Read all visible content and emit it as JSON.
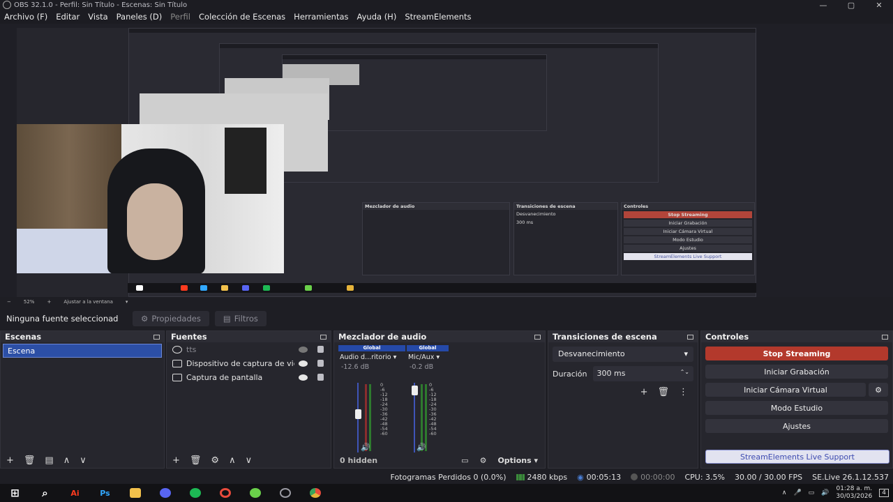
{
  "window": {
    "title": "OBS 32.1.0 - Perfil: Sin Título - Escenas: Sin Título",
    "min": "—",
    "max": "▢",
    "close": "✕"
  },
  "menu": [
    {
      "label": "Archivo (F)"
    },
    {
      "label": "Editar"
    },
    {
      "label": "Vista"
    },
    {
      "label": "Paneles (D)"
    },
    {
      "label": "Perfil",
      "disabled": true
    },
    {
      "label": "Colección de Escenas"
    },
    {
      "label": "Herramientas"
    },
    {
      "label": "Ayuda (H)"
    },
    {
      "label": "StreamElements"
    }
  ],
  "zoom": {
    "minus": "−",
    "value": "52%",
    "plus": "+",
    "fit": "Ajustar a la ventana",
    "arrow": "▾"
  },
  "context": {
    "no_source": "Ninguna fuente seleccionad",
    "properties": "Propiedades",
    "filters": "Filtros"
  },
  "scenes": {
    "title": "Escenas",
    "items": [
      "Escena"
    ]
  },
  "sources": {
    "title": "Fuentes",
    "items": [
      {
        "name": "tts",
        "visible": false
      },
      {
        "name": "Dispositivo de captura de vid",
        "visible": true
      },
      {
        "name": "Captura de pantalla",
        "visible": true
      }
    ]
  },
  "mixer": {
    "title": "Mezclador de audio",
    "global_label": "Global",
    "channels": [
      {
        "name": "Audio d...ritorio",
        "db": "-12.6 dB"
      },
      {
        "name": "Mic/Aux",
        "db": "-0.2 dB"
      }
    ],
    "scale": [
      "0",
      "-6",
      "-12",
      "-18",
      "-24",
      "-30",
      "-36",
      "-42",
      "-48",
      "-54",
      "-60"
    ],
    "hidden": "0 hidden",
    "options": "Options"
  },
  "transitions": {
    "title": "Transiciones de escena",
    "selected": "Desvanecimiento",
    "duration_label": "Duración",
    "duration_value": "300 ms"
  },
  "controls": {
    "title": "Controles",
    "stop_streaming": "Stop Streaming",
    "start_recording": "Iniciar Grabación",
    "virtual_cam": "Iniciar Cámara Virtual",
    "studio_mode": "Modo Estudio",
    "settings": "Ajustes",
    "se_support": "StreamElements Live Support"
  },
  "status": {
    "dropped": "Fotogramas Perdidos 0 (0.0%)",
    "bitrate": "2480 kbps",
    "stream_time": "00:05:13",
    "rec_time": "00:00:00",
    "cpu": "CPU: 3.5%",
    "fps": "30.00 / 30.00 FPS",
    "version": "SE.Live 26.1.12.537"
  },
  "taskbar": {
    "time": "01:28 a. m.",
    "date": "30/03/2026",
    "notif": "4",
    "apps": [
      {
        "icon": "windows-icon",
        "label": "⊞",
        "color": "#ffffff"
      },
      {
        "icon": "search-icon",
        "label": "⌕",
        "color": "#ffffff"
      },
      {
        "icon": "illustrator-icon",
        "label": "Ai",
        "color": "#ff3b1f"
      },
      {
        "icon": "photoshop-icon",
        "label": "Ps",
        "color": "#31a8ff"
      },
      {
        "icon": "folder-icon",
        "label": "",
        "color": "#f2c14b"
      },
      {
        "icon": "discord-icon",
        "label": "",
        "color": "#5865f2"
      },
      {
        "icon": "spotify-icon",
        "label": "",
        "color": "#1db954"
      },
      {
        "icon": "app-icon",
        "label": "",
        "color": "#e94b3c"
      },
      {
        "icon": "xbox-icon",
        "label": "",
        "color": "#6ad04a"
      },
      {
        "icon": "obs-icon",
        "label": "",
        "color": "#9a9aa2"
      },
      {
        "icon": "chrome-icon",
        "label": "",
        "color": "#e6b33a"
      }
    ]
  }
}
